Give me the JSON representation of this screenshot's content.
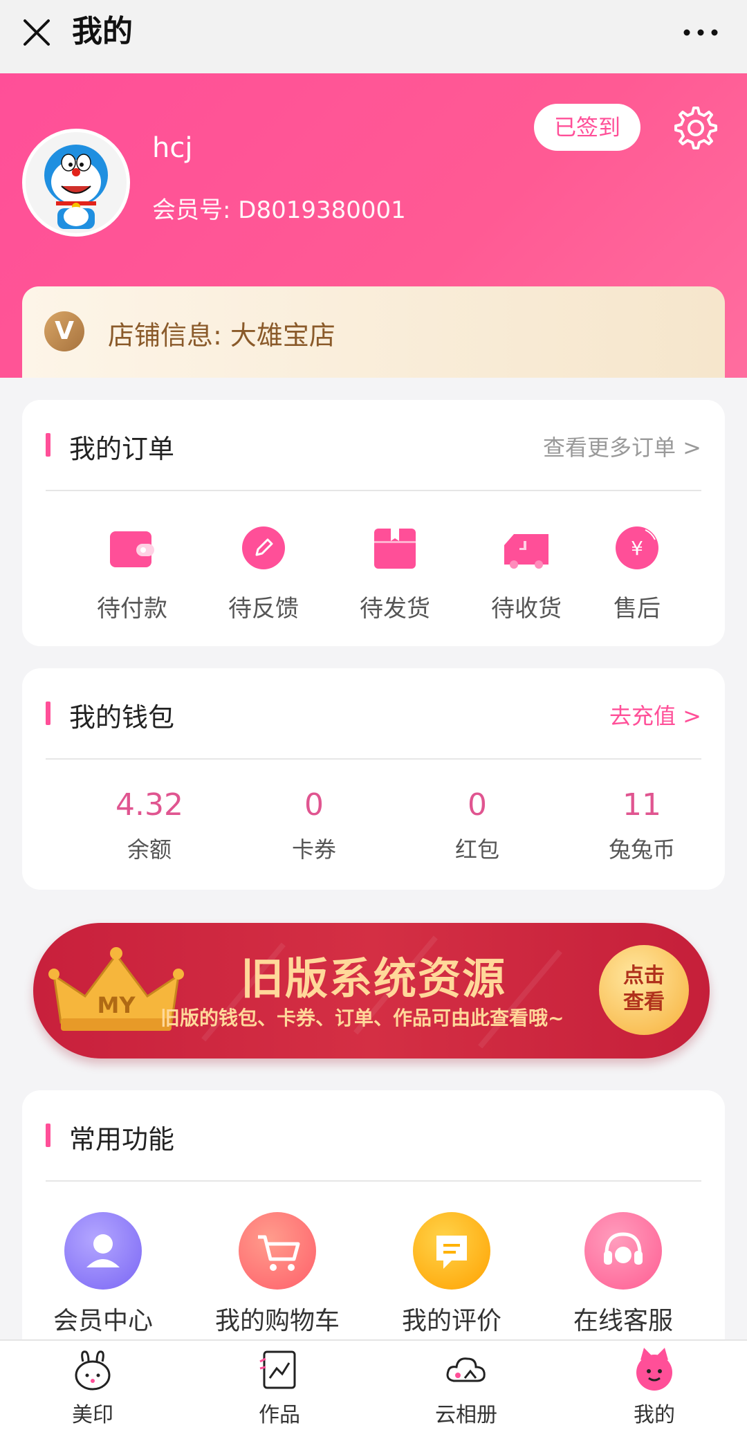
{
  "topbar": {
    "title": "我的"
  },
  "profile": {
    "username": "hcj",
    "member_label": "会员号: D8019380001",
    "signed_label": "已签到"
  },
  "shop": {
    "badge": "V",
    "text": "店铺信息: 大雄宝店"
  },
  "orders": {
    "title": "我的订单",
    "more": "查看更多订单 >",
    "items": [
      {
        "label": "待付款",
        "icon": "wallet-icon"
      },
      {
        "label": "待反馈",
        "icon": "pencil-icon"
      },
      {
        "label": "待发货",
        "icon": "box-icon"
      },
      {
        "label": "待收货",
        "icon": "truck-icon"
      },
      {
        "label": "售后",
        "icon": "yen-icon"
      }
    ]
  },
  "wallet": {
    "title": "我的钱包",
    "recharge": "去充值 >",
    "items": [
      {
        "value": "4.32",
        "label": "余额"
      },
      {
        "value": "0",
        "label": "卡券"
      },
      {
        "value": "0",
        "label": "红包"
      },
      {
        "value": "11",
        "label": "兔兔币"
      }
    ]
  },
  "banner": {
    "crown_text": "MY",
    "title": "旧版系统资源",
    "subtitle": "旧版的钱包、卡券、订单、作品可由此查看哦~",
    "button_line1": "点击",
    "button_line2": "查看"
  },
  "functions": {
    "title": "常用功能",
    "items": [
      {
        "label": "会员中心",
        "icon": "member-icon",
        "color": "#8f7dfb"
      },
      {
        "label": "我的购物车",
        "icon": "cart-icon",
        "color": "#ff6f6f"
      },
      {
        "label": "我的评价",
        "icon": "comment-icon",
        "color": "#ffb400"
      },
      {
        "label": "在线客服",
        "icon": "headset-icon",
        "color": "#ff6f9c"
      }
    ]
  },
  "tabbar": {
    "items": [
      {
        "label": "美印",
        "icon": "bunny-icon"
      },
      {
        "label": "作品",
        "icon": "works-icon"
      },
      {
        "label": "云相册",
        "icon": "cloud-album-icon"
      },
      {
        "label": "我的",
        "icon": "me-icon"
      }
    ]
  },
  "colors": {
    "brand_pink": "#ff4f98",
    "number_pink": "#e05590"
  }
}
